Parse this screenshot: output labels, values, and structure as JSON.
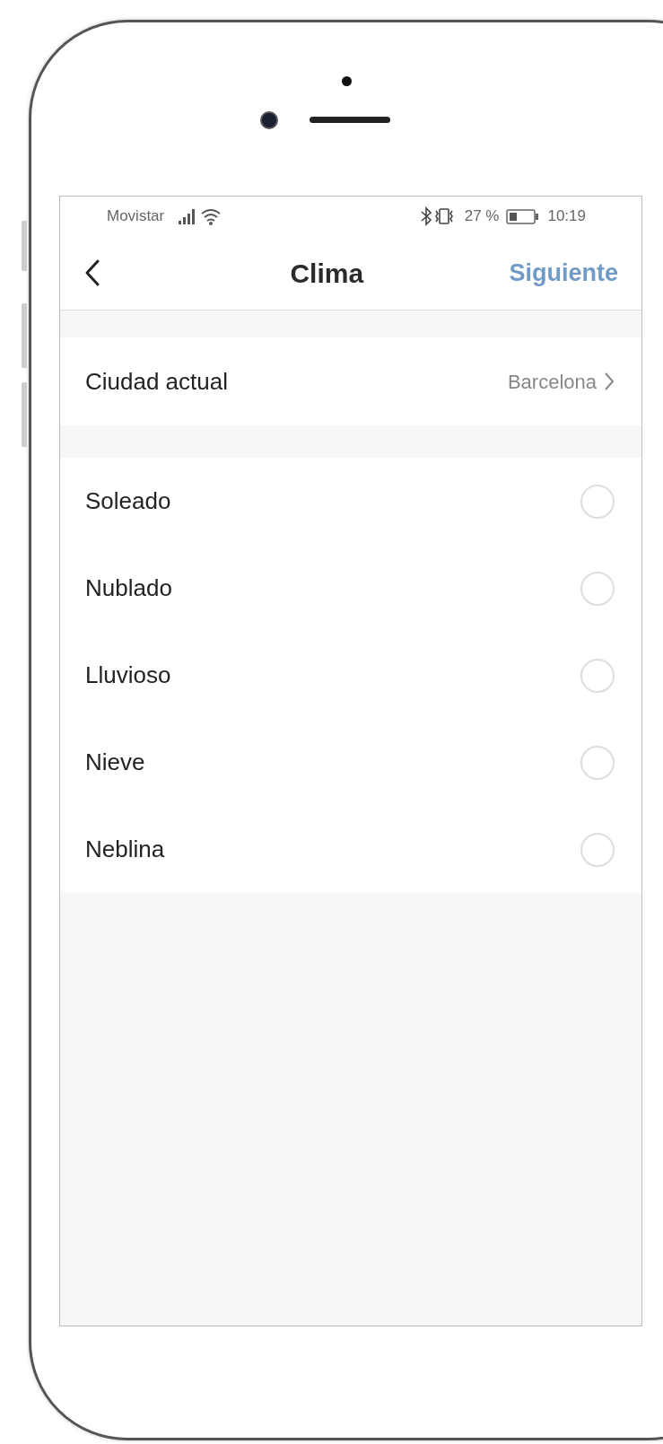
{
  "status_bar": {
    "carrier": "Movistar",
    "battery": "27 %",
    "time": "10:19"
  },
  "header": {
    "title": "Clima",
    "action": "Siguiente"
  },
  "city_row": {
    "label": "Ciudad actual",
    "value": "Barcelona"
  },
  "options": [
    {
      "label": "Soleado",
      "selected": false
    },
    {
      "label": "Nublado",
      "selected": false
    },
    {
      "label": "Lluvioso",
      "selected": false
    },
    {
      "label": "Nieve",
      "selected": false
    },
    {
      "label": "Neblina",
      "selected": false
    }
  ]
}
